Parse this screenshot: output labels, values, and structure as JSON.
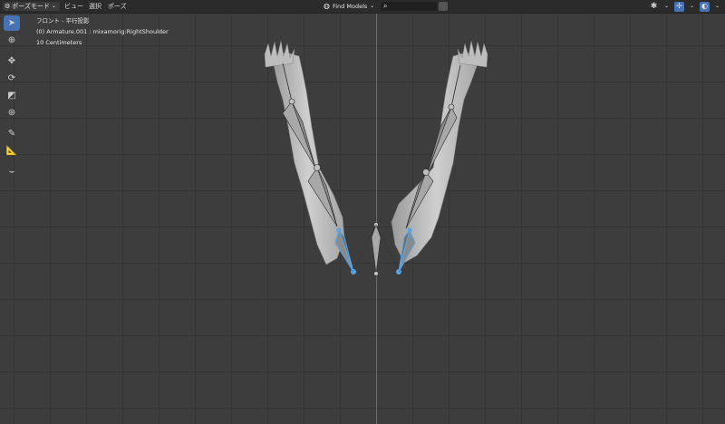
{
  "header": {
    "mode_label": "ポーズモード",
    "menu": [
      "ビュー",
      "選択",
      "ポーズ"
    ],
    "find_models": "Find Models"
  },
  "overlay": {
    "view_name": "フロント - 平行投影",
    "active_object": "(0) Armature.001 : mixamorig:RightShoulder",
    "scale": "10 Centimeters"
  },
  "toolbar": {
    "tools": [
      "select-tool",
      "cursor-tool",
      "move-tool",
      "rotate-tool",
      "scale-tool",
      "transform-tool",
      "annotate-tool",
      "measure-tool",
      "pose-tool"
    ],
    "active": "select-tool"
  },
  "colors": {
    "background": "#3d3d3d",
    "grid": "#353535",
    "z_axis": "#4b6fae",
    "selected_bone": "#57a6e8",
    "active_tool": "#4772b3"
  }
}
